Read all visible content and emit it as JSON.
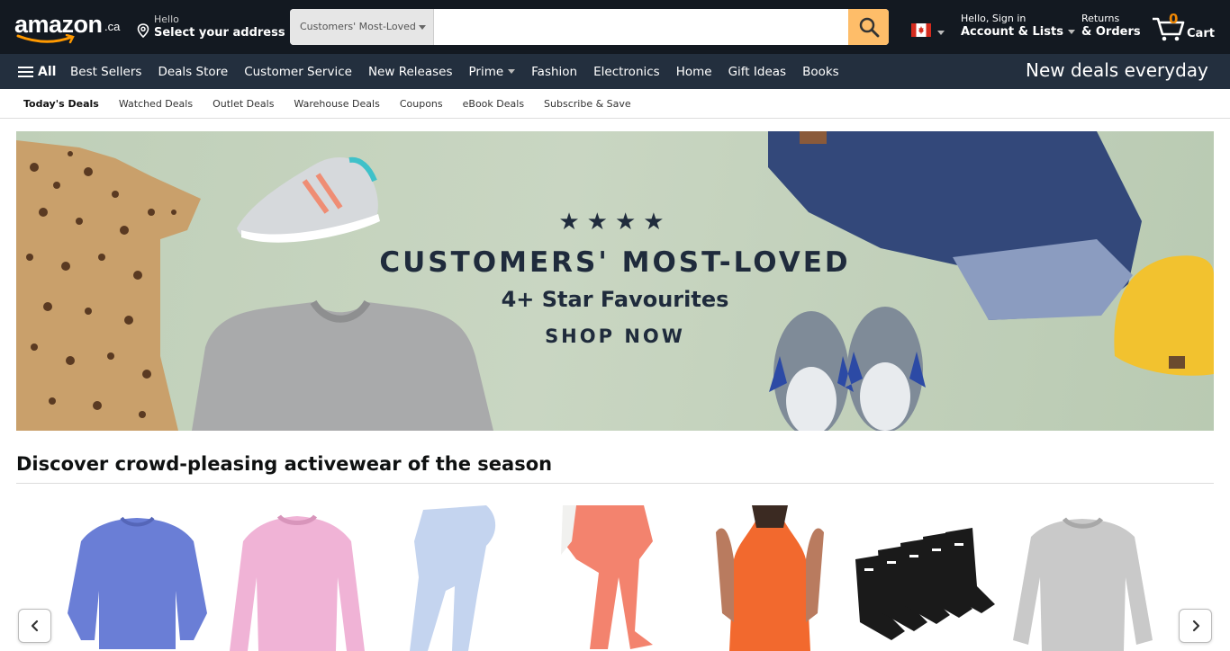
{
  "header": {
    "logo_text": "amazon",
    "logo_tld": ".ca",
    "address_line1": "Hello",
    "address_line2": "Select your address",
    "search_category": "Customers' Most-Loved",
    "search_placeholder": "",
    "account_line1": "Hello, Sign in",
    "account_line2": "Account & Lists",
    "returns_line1": "Returns",
    "returns_line2": "& Orders",
    "cart_count": "0",
    "cart_label": "Cart",
    "colors": {
      "topbar": "#131921",
      "navbar": "#232f3e",
      "search_button": "#febd69",
      "cart_count": "#f08804"
    }
  },
  "nav": {
    "all_label": "All",
    "items": [
      "Best Sellers",
      "Deals Store",
      "Customer Service",
      "New Releases",
      "Prime",
      "Fashion",
      "Electronics",
      "Home",
      "Gift Ideas",
      "Books"
    ],
    "promo": "New deals everyday"
  },
  "subnav": {
    "items": [
      "Today's Deals",
      "Watched Deals",
      "Outlet Deals",
      "Warehouse Deals",
      "Coupons",
      "eBook Deals",
      "Subscribe & Save"
    ]
  },
  "hero": {
    "stars": "★★★★",
    "title": "CUSTOMERS' MOST-LOVED",
    "subtitle": "4+ Star Favourites",
    "cta": "SHOP NOW"
  },
  "section": {
    "title": "Discover crowd-pleasing activewear of the season",
    "products": [
      {
        "icon": "purple-cropped-sweatshirt"
      },
      {
        "icon": "pink-sweatshirt"
      },
      {
        "icon": "light-blue-leggings"
      },
      {
        "icon": "coral-joggers"
      },
      {
        "icon": "orange-tank-top"
      },
      {
        "icon": "black-socks"
      },
      {
        "icon": "grey-sweatshirt"
      }
    ]
  }
}
